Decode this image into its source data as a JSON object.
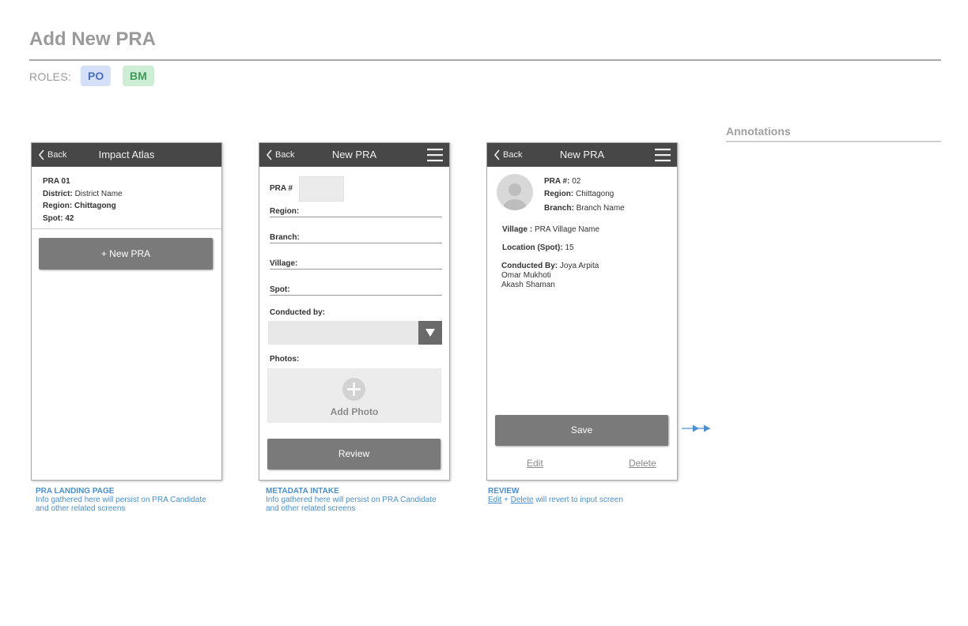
{
  "page": {
    "title": "Add New PRA",
    "roles_label": "ROLES:",
    "roles": [
      "PO",
      "BM"
    ],
    "role_colors": {
      "PO": "#d4e0f7",
      "BM": "#cdeed5"
    },
    "annotations_title": "Annotations"
  },
  "screen1": {
    "back_label": "Back",
    "title": "Impact Atlas",
    "pra_id": "PRA 01",
    "district_label": "District:",
    "district_value": "District Name",
    "region_label": "Region:",
    "region_value": "Chittagong",
    "spot_label": "Spot:",
    "spot_value": "42",
    "new_button": "+ New PRA",
    "caption_title": "PRA LANDING PAGE",
    "caption_line1": "Info gathered here will persist on PRA Candidate",
    "caption_line2": "and other related screens"
  },
  "screen2": {
    "back_label": "Back",
    "title": "New PRA",
    "pra_label": "PRA #",
    "pra_value": "",
    "region_label": "Region:",
    "branch_label": "Branch:",
    "village_label": "Village:",
    "spot_label": "Spot:",
    "conducted_label": "Conducted by:",
    "conducted_value": "",
    "photos_label": "Photos:",
    "add_photo": "Add Photo",
    "review_button": "Review",
    "caption_title": "METADATA INTAKE",
    "caption_line1": "Info gathered here will persist on PRA Candidate",
    "caption_line2": "and other related screens"
  },
  "screen3": {
    "back_label": "Back",
    "title": "New PRA",
    "pra_label": "PRA #:",
    "pra_value": "02",
    "region_label": "Region:",
    "region_value": "Chittagong",
    "branch_label": "Branch:",
    "branch_value": "Branch Name",
    "village_label": "Village :",
    "village_value": "PRA Village Name",
    "location_label": "Location (Spot):",
    "location_value": "15",
    "conducted_label": "Conducted By:",
    "conducted_people": [
      "Joya Arpita",
      "Omar Mukhoti",
      "Akash Shaman"
    ],
    "save_button": "Save",
    "edit_link": "Edit",
    "delete_link": "Delete",
    "caption_title": "REVIEW",
    "caption_edit": "Edit",
    "caption_plus": "+",
    "caption_delete": "Delete",
    "caption_rest": "will revert to input screen"
  },
  "icons": [
    "chevron-left-icon",
    "hamburger-menu-icon",
    "dropdown-arrow-icon",
    "plus-icon",
    "user-avatar-icon",
    "flow-arrow-icon"
  ],
  "colors": {
    "appbar": "#474747",
    "button": "#7a7a7a",
    "caption": "#4a8fd0"
  }
}
